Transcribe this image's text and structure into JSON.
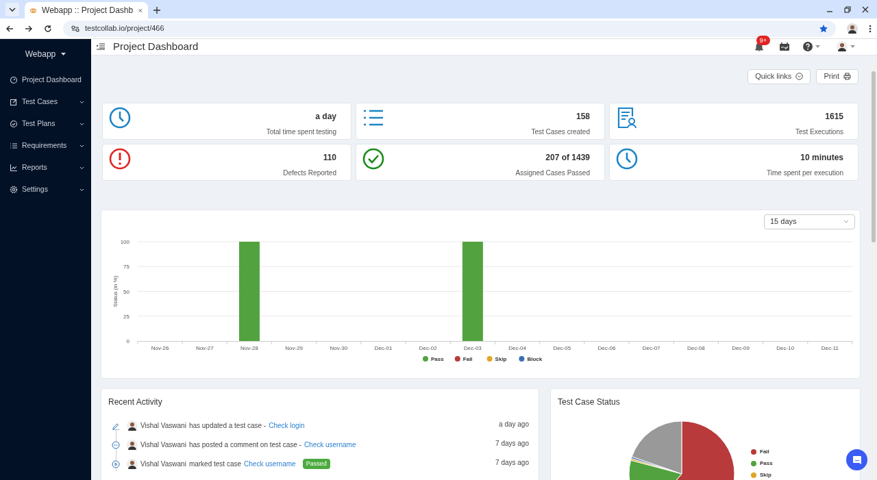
{
  "browser": {
    "tab_title": "Webapp :: Project Dashb",
    "url": "testcollab.io/project/466"
  },
  "sidebar": {
    "project": "Webapp",
    "items": [
      {
        "label": "Project Dashboard",
        "expandable": false
      },
      {
        "label": "Test Cases",
        "expandable": true
      },
      {
        "label": "Test Plans",
        "expandable": true
      },
      {
        "label": "Requirements",
        "expandable": true
      },
      {
        "label": "Reports",
        "expandable": true
      },
      {
        "label": "Settings",
        "expandable": true
      }
    ]
  },
  "header": {
    "title": "Project Dashboard",
    "notification_count": "9+"
  },
  "toolbar": {
    "buttons": [
      "Quick links",
      "Print"
    ]
  },
  "stats": [
    {
      "value": "a day",
      "label": "Total time spent testing"
    },
    {
      "value": "158",
      "label": "Test Cases created"
    },
    {
      "value": "1615",
      "label": "Test Executions"
    },
    {
      "value": "110",
      "label": "Defects Reported"
    },
    {
      "value": "207 of 1439",
      "label": "Assigned Cases Passed"
    },
    {
      "value": "10 minutes",
      "label": "Time spent per execution"
    }
  ],
  "status_chart": {
    "range": "15 days",
    "chart_data": {
      "type": "bar",
      "stacked": true,
      "grid": true,
      "ylabel": "Status (in %)",
      "yticks": [
        0,
        25,
        50,
        75,
        100
      ],
      "ylim": [
        0,
        100
      ],
      "categories": [
        "Nov-26",
        "Nov-27",
        "Nov-28",
        "Nov-29",
        "Nov-30",
        "Dec-01",
        "Dec-02",
        "Dec-03",
        "Dec-04",
        "Dec-05",
        "Dec-06",
        "Dec-07",
        "Dec-08",
        "Dec-09",
        "Dec-10",
        "Dec-11"
      ],
      "series": [
        {
          "name": "Pass",
          "color": "#52a33f",
          "values": [
            0,
            0,
            100,
            0,
            0,
            0,
            0,
            100,
            0,
            0,
            0,
            0,
            0,
            0,
            0,
            0
          ]
        },
        {
          "name": "Fail",
          "color": "#b83a3a",
          "values": [
            0,
            0,
            0,
            0,
            0,
            0,
            0,
            0,
            0,
            0,
            0,
            0,
            0,
            0,
            0,
            0
          ]
        },
        {
          "name": "Skip",
          "color": "#e0a526",
          "values": [
            0,
            0,
            0,
            0,
            0,
            0,
            0,
            0,
            0,
            0,
            0,
            0,
            0,
            0,
            0,
            0
          ]
        },
        {
          "name": "Block",
          "color": "#3d6fb0",
          "values": [
            0,
            0,
            0,
            0,
            0,
            0,
            0,
            0,
            0,
            0,
            0,
            0,
            0,
            0,
            0,
            0
          ]
        }
      ]
    }
  },
  "recent_activity": {
    "title": "Recent Activity",
    "items": [
      {
        "kind": "update",
        "user": "Vishal Vaswani",
        "action": "has updated a test case -",
        "link": "Check login",
        "time": "a day ago"
      },
      {
        "kind": "comment",
        "user": "Vishal Vaswani",
        "action": "has posted a comment on test case -",
        "link": "Check username",
        "time": "7 days ago"
      },
      {
        "kind": "result",
        "user": "Vishal Vaswani",
        "action": "marked test case",
        "link": "Check username",
        "badge": "Passed",
        "time": "7 days ago"
      }
    ]
  },
  "test_case_status": {
    "title": "Test Case Status",
    "legend": [
      {
        "label": "Fail",
        "color": "#b83a3a"
      },
      {
        "label": "Pass",
        "color": "#52a33f"
      },
      {
        "label": "Skip",
        "color": "#e0a526"
      }
    ]
  }
}
